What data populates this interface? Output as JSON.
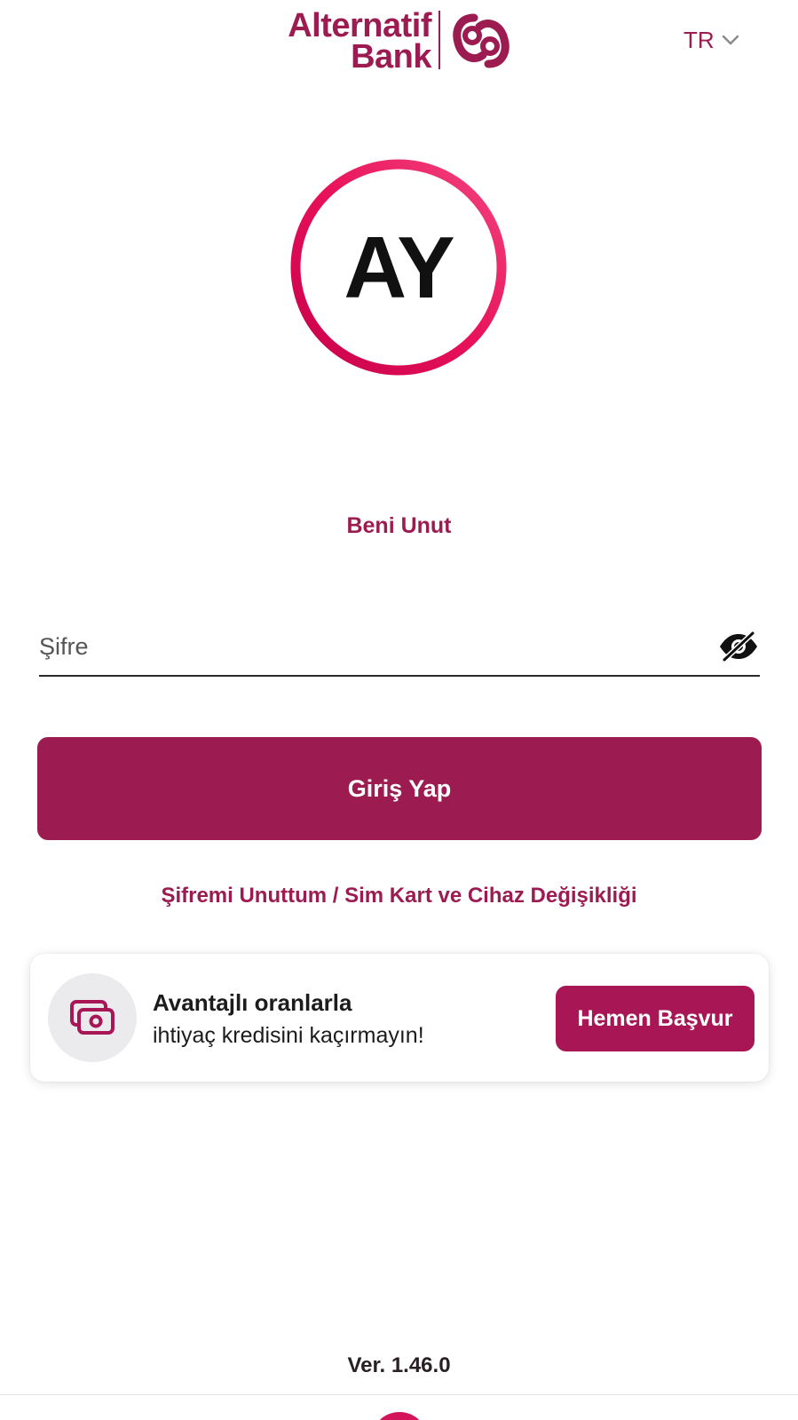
{
  "header": {
    "logo_line1": "Alternatif",
    "logo_line2": "Bank",
    "language": "TR",
    "language_icon": "chevron-down-icon"
  },
  "avatar": {
    "initials": "AY"
  },
  "forget_me": "Beni Unut",
  "password": {
    "placeholder": "Şifre",
    "value": "",
    "visibility_icon": "eye-off-icon"
  },
  "login_button": "Giriş Yap",
  "reset_link": "Şifremi Unuttum / Sim Kart ve Cihaz Değişikliği",
  "promo": {
    "icon": "cash-icon",
    "title": "Avantajlı oranlarla",
    "subtitle": "ihtiyaç kredisini kaçırmayın!",
    "button": "Hemen Başvur"
  },
  "version": "Ver. 1.46.0",
  "colors": {
    "brand": "#9c1c52",
    "accent": "#d3145a"
  }
}
